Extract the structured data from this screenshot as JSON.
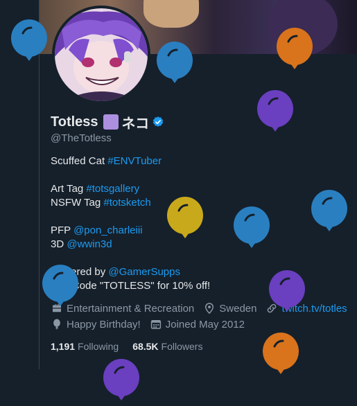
{
  "profile": {
    "display_name": "Totless",
    "name_suffix": "ネコ",
    "handle": "@TheTotless",
    "bio_line1_text": "Scuffed Cat ",
    "bio_line1_tag": "#ENVTuber",
    "bio_line2_text": "Art Tag ",
    "bio_line2_tag": "#totsgallery",
    "bio_line3_text": "NSFW Tag ",
    "bio_line3_tag": "#totsketch",
    "bio_line4_text": "PFP ",
    "bio_line4_mention": "@pon_charleiii",
    "bio_line5_text": "3D ",
    "bio_line5_mention": "@wwin3d",
    "bio_line6_text": "Powered by ",
    "bio_line6_mention": "@GamerSupps",
    "bio_line7_text": "Use Code \"TOTLESS\" for 10% off!"
  },
  "meta": {
    "category": "Entertainment & Recreation",
    "location": "Sweden",
    "website": "twitch.tv/totles",
    "birthday": "Happy Birthday!",
    "joined": "Joined May 2012"
  },
  "stats": {
    "following_count": "1,191",
    "following_label": "Following",
    "followers_count": "68.5K",
    "followers_label": "Followers"
  },
  "colors": {
    "background": "#15202b",
    "link": "#1d9bf0",
    "muted": "#8b98a5",
    "balloon_blue": "#2a7fc0",
    "balloon_orange": "#d9731c",
    "balloon_purple": "#6a3fc0",
    "balloon_gold": "#c9a91c"
  }
}
